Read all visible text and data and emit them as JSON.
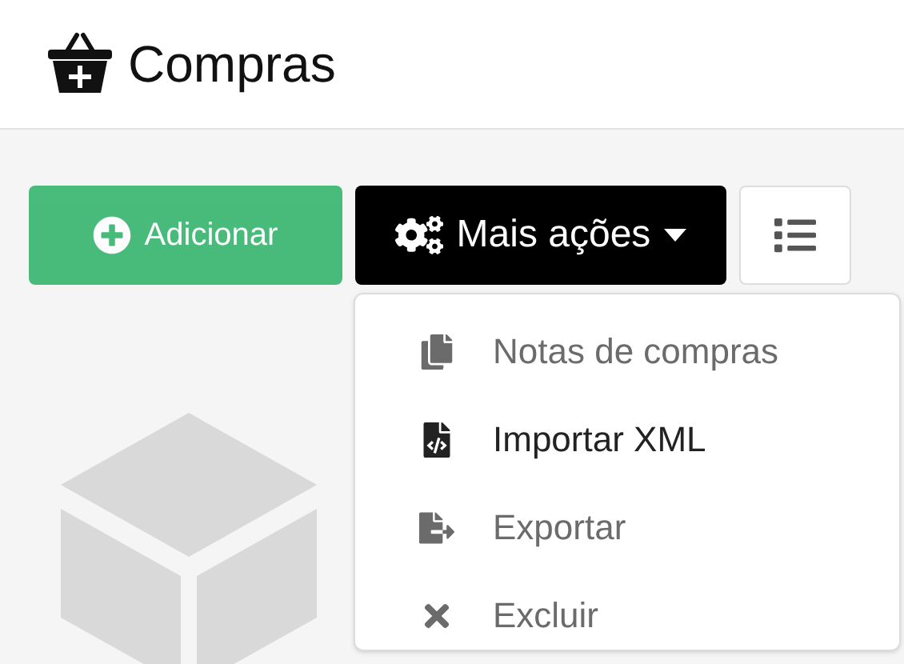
{
  "header": {
    "title": "Compras"
  },
  "toolbar": {
    "add_button": {
      "label": "Adicionar",
      "blurred": true
    },
    "more_button": {
      "label": "Mais ações",
      "expanded": true
    }
  },
  "menu": [
    {
      "label": "Notas de compras",
      "kind": "notes",
      "blurred": true
    },
    {
      "label": "Importar XML",
      "kind": "xml",
      "blurred": false
    },
    {
      "label": "Exportar",
      "kind": "export",
      "blurred": true
    },
    {
      "label": "Excluir",
      "kind": "delete",
      "blurred": true
    }
  ]
}
